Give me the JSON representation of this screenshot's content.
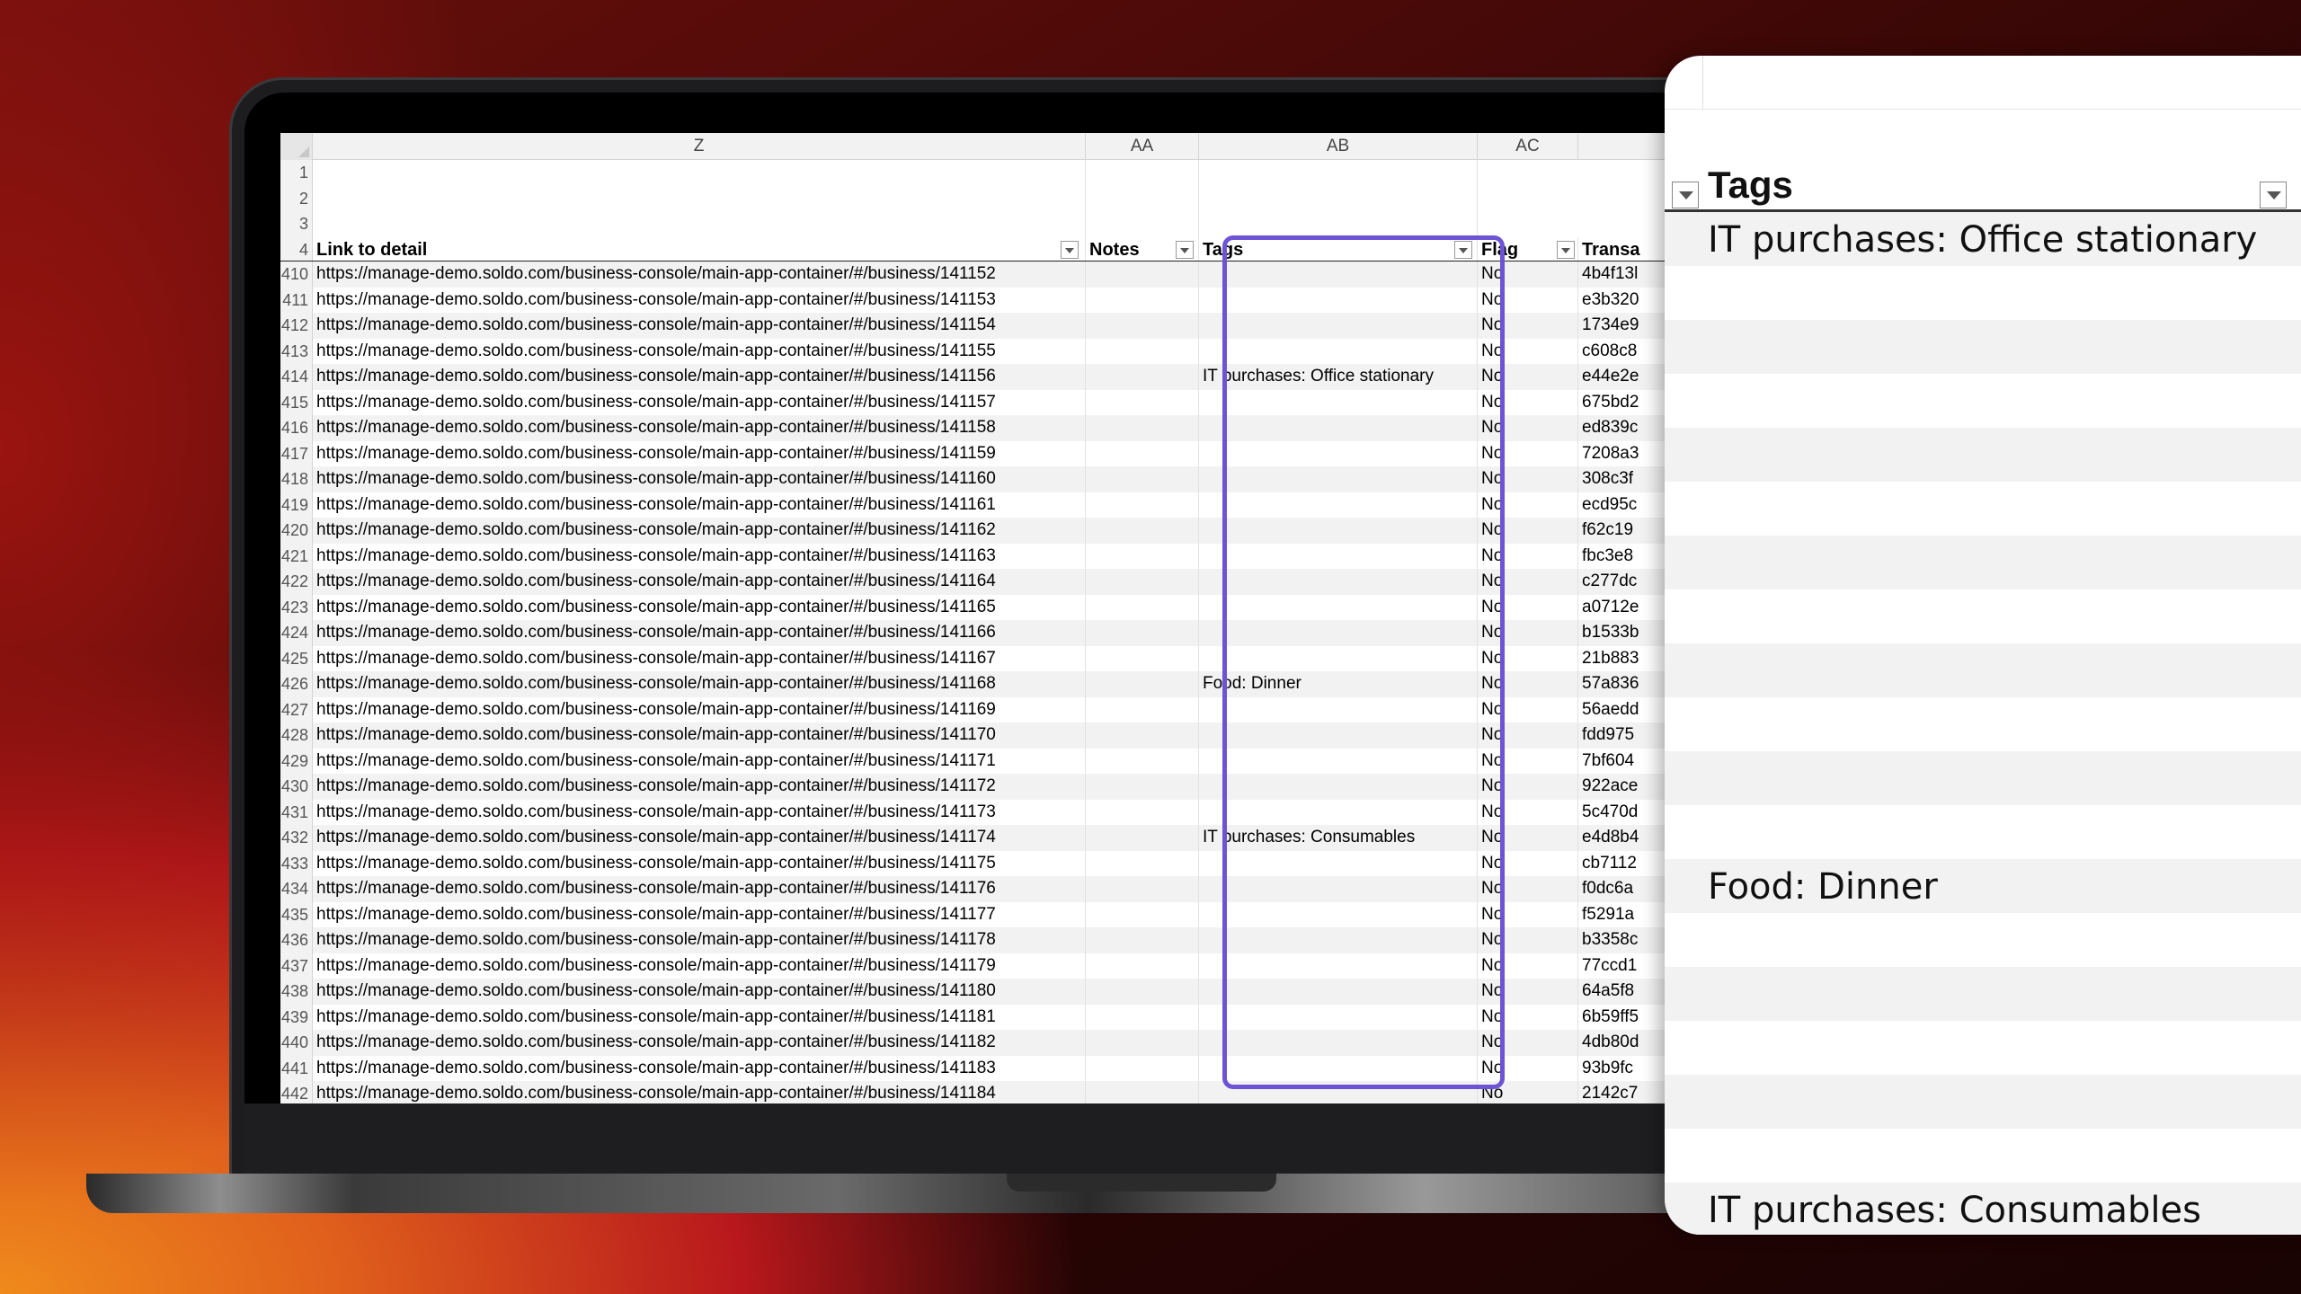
{
  "sheet": {
    "columns": [
      "Z",
      "AA",
      "AB",
      "AC"
    ],
    "top_rows": [
      "1",
      "2",
      "3"
    ],
    "header_row_num": "4",
    "headers": {
      "link": "Link to detail",
      "notes": "Notes",
      "tags": "Tags",
      "flag": "Flag",
      "transaction": "Transa"
    },
    "rows": [
      {
        "num": "410",
        "link": "https://manage-demo.soldo.com/business-console/main-app-container/#/business/141152",
        "tags": "",
        "flag": "No",
        "tx": "4b4f13l"
      },
      {
        "num": "411",
        "link": "https://manage-demo.soldo.com/business-console/main-app-container/#/business/141153",
        "tags": "",
        "flag": "No",
        "tx": "e3b320"
      },
      {
        "num": "412",
        "link": "https://manage-demo.soldo.com/business-console/main-app-container/#/business/141154",
        "tags": "",
        "flag": "No",
        "tx": "1734e9"
      },
      {
        "num": "413",
        "link": "https://manage-demo.soldo.com/business-console/main-app-container/#/business/141155",
        "tags": "",
        "flag": "No",
        "tx": "c608c8"
      },
      {
        "num": "414",
        "link": "https://manage-demo.soldo.com/business-console/main-app-container/#/business/141156",
        "tags": "IT purchases: Office stationary",
        "flag": "No",
        "tx": "e44e2e"
      },
      {
        "num": "415",
        "link": "https://manage-demo.soldo.com/business-console/main-app-container/#/business/141157",
        "tags": "",
        "flag": "No",
        "tx": "675bd2"
      },
      {
        "num": "416",
        "link": "https://manage-demo.soldo.com/business-console/main-app-container/#/business/141158",
        "tags": "",
        "flag": "No",
        "tx": "ed839c"
      },
      {
        "num": "417",
        "link": "https://manage-demo.soldo.com/business-console/main-app-container/#/business/141159",
        "tags": "",
        "flag": "No",
        "tx": "7208a3"
      },
      {
        "num": "418",
        "link": "https://manage-demo.soldo.com/business-console/main-app-container/#/business/141160",
        "tags": "",
        "flag": "No",
        "tx": "308c3f"
      },
      {
        "num": "419",
        "link": "https://manage-demo.soldo.com/business-console/main-app-container/#/business/141161",
        "tags": "",
        "flag": "No",
        "tx": "ecd95c"
      },
      {
        "num": "420",
        "link": "https://manage-demo.soldo.com/business-console/main-app-container/#/business/141162",
        "tags": "",
        "flag": "No",
        "tx": "f62c19"
      },
      {
        "num": "421",
        "link": "https://manage-demo.soldo.com/business-console/main-app-container/#/business/141163",
        "tags": "",
        "flag": "No",
        "tx": "fbc3e8"
      },
      {
        "num": "422",
        "link": "https://manage-demo.soldo.com/business-console/main-app-container/#/business/141164",
        "tags": "",
        "flag": "No",
        "tx": "c277dc"
      },
      {
        "num": "423",
        "link": "https://manage-demo.soldo.com/business-console/main-app-container/#/business/141165",
        "tags": "",
        "flag": "No",
        "tx": "a0712e"
      },
      {
        "num": "424",
        "link": "https://manage-demo.soldo.com/business-console/main-app-container/#/business/141166",
        "tags": "",
        "flag": "No",
        "tx": "b1533b"
      },
      {
        "num": "425",
        "link": "https://manage-demo.soldo.com/business-console/main-app-container/#/business/141167",
        "tags": "",
        "flag": "No",
        "tx": "21b883"
      },
      {
        "num": "426",
        "link": "https://manage-demo.soldo.com/business-console/main-app-container/#/business/141168",
        "tags": "Food: Dinner",
        "flag": "No",
        "tx": "57a836"
      },
      {
        "num": "427",
        "link": "https://manage-demo.soldo.com/business-console/main-app-container/#/business/141169",
        "tags": "",
        "flag": "No",
        "tx": "56aedd"
      },
      {
        "num": "428",
        "link": "https://manage-demo.soldo.com/business-console/main-app-container/#/business/141170",
        "tags": "",
        "flag": "No",
        "tx": "fdd975"
      },
      {
        "num": "429",
        "link": "https://manage-demo.soldo.com/business-console/main-app-container/#/business/141171",
        "tags": "",
        "flag": "No",
        "tx": "7bf604"
      },
      {
        "num": "430",
        "link": "https://manage-demo.soldo.com/business-console/main-app-container/#/business/141172",
        "tags": "",
        "flag": "No",
        "tx": "922ace"
      },
      {
        "num": "431",
        "link": "https://manage-demo.soldo.com/business-console/main-app-container/#/business/141173",
        "tags": "",
        "flag": "No",
        "tx": "5c470d"
      },
      {
        "num": "432",
        "link": "https://manage-demo.soldo.com/business-console/main-app-container/#/business/141174",
        "tags": "IT purchases: Consumables",
        "flag": "No",
        "tx": "e4d8b4"
      },
      {
        "num": "433",
        "link": "https://manage-demo.soldo.com/business-console/main-app-container/#/business/141175",
        "tags": "",
        "flag": "No",
        "tx": "cb7112"
      },
      {
        "num": "434",
        "link": "https://manage-demo.soldo.com/business-console/main-app-container/#/business/141176",
        "tags": "",
        "flag": "No",
        "tx": "f0dc6a"
      },
      {
        "num": "435",
        "link": "https://manage-demo.soldo.com/business-console/main-app-container/#/business/141177",
        "tags": "",
        "flag": "No",
        "tx": "f5291a"
      },
      {
        "num": "436",
        "link": "https://manage-demo.soldo.com/business-console/main-app-container/#/business/141178",
        "tags": "",
        "flag": "No",
        "tx": "b3358c"
      },
      {
        "num": "437",
        "link": "https://manage-demo.soldo.com/business-console/main-app-container/#/business/141179",
        "tags": "",
        "flag": "No",
        "tx": "77ccd1"
      },
      {
        "num": "438",
        "link": "https://manage-demo.soldo.com/business-console/main-app-container/#/business/141180",
        "tags": "",
        "flag": "No",
        "tx": "64a5f8"
      },
      {
        "num": "439",
        "link": "https://manage-demo.soldo.com/business-console/main-app-container/#/business/141181",
        "tags": "",
        "flag": "No",
        "tx": "6b59ff5"
      },
      {
        "num": "440",
        "link": "https://manage-demo.soldo.com/business-console/main-app-container/#/business/141182",
        "tags": "",
        "flag": "No",
        "tx": "4db80d"
      },
      {
        "num": "441",
        "link": "https://manage-demo.soldo.com/business-console/main-app-container/#/business/141183",
        "tags": "",
        "flag": "No",
        "tx": "93b9fc"
      },
      {
        "num": "442",
        "link": "https://manage-demo.soldo.com/business-console/main-app-container/#/business/141184",
        "tags": "",
        "flag": "No",
        "tx": "2142c7"
      }
    ]
  },
  "zoom": {
    "title": "Tags",
    "items": [
      "IT purchases: Office stationary",
      "Food: Dinner",
      "IT purchases: Consumables"
    ]
  },
  "colors": {
    "highlight": "#6c54d4"
  }
}
